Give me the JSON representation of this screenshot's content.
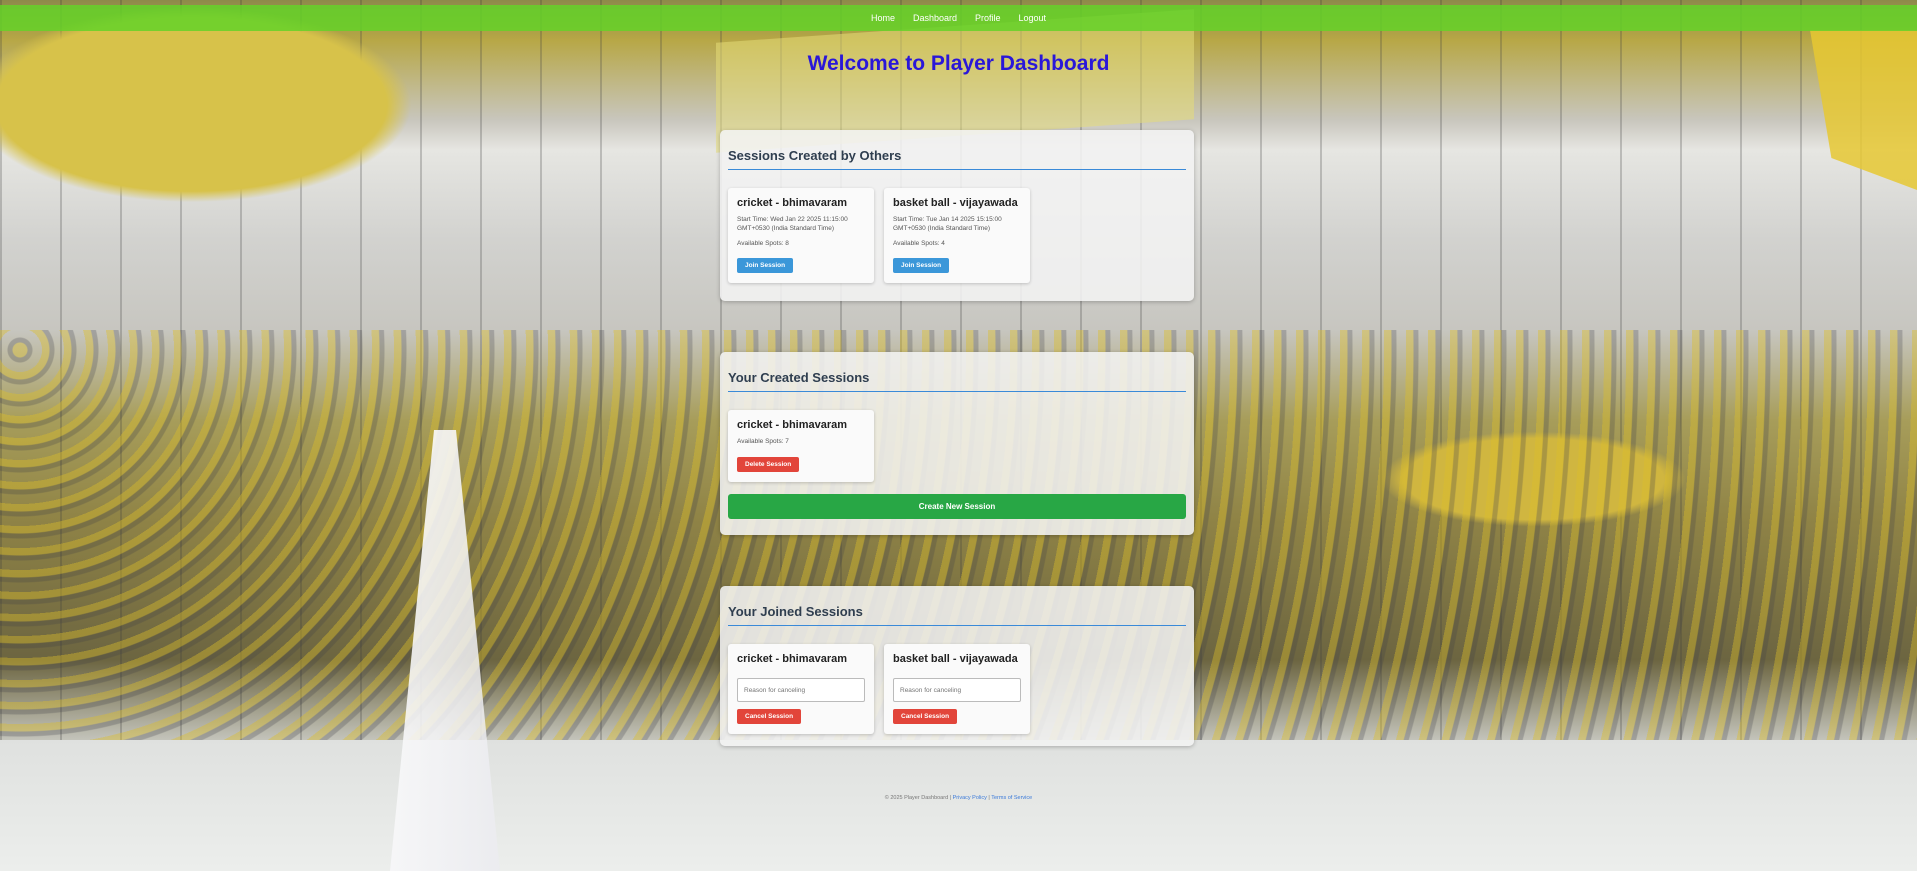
{
  "nav": {
    "items": [
      "Home",
      "Dashboard",
      "Profile",
      "Logout"
    ]
  },
  "page_title": "Welcome to Player Dashboard",
  "others": {
    "title": "Sessions Created by Others",
    "cards": [
      {
        "title": "cricket - bhimavaram",
        "start_time": "Start Time: Wed Jan 22 2025 11:15:00 GMT+0530 (India Standard Time)",
        "spots": "Available Spots: 8",
        "button": "Join Session"
      },
      {
        "title": "basket ball - vijayawada",
        "start_time": "Start Time: Tue Jan 14 2025 15:15:00 GMT+0530 (India Standard Time)",
        "spots": "Available Spots: 4",
        "button": "Join Session"
      }
    ]
  },
  "created": {
    "title": "Your Created Sessions",
    "cards": [
      {
        "title": "cricket - bhimavaram",
        "spots": "Available Spots: 7",
        "button": "Delete Session"
      }
    ],
    "create_button": "Create New Session"
  },
  "joined": {
    "title": "Your Joined Sessions",
    "cards": [
      {
        "title": "cricket - bhimavaram",
        "placeholder": "Reason for canceling",
        "button": "Cancel Session"
      },
      {
        "title": "basket ball - vijayawada",
        "placeholder": "Reason for canceling",
        "button": "Cancel Session"
      }
    ]
  },
  "footer": {
    "copyright": "© 2025 Player Dashboard | ",
    "privacy": "Privacy Policy",
    "separator": " | ",
    "terms": "Terms of Service"
  },
  "colors": {
    "nav": "#64d228",
    "title": "#2a17d8",
    "join": "#3b97d9",
    "danger": "#e2453a",
    "create": "#28a745"
  }
}
